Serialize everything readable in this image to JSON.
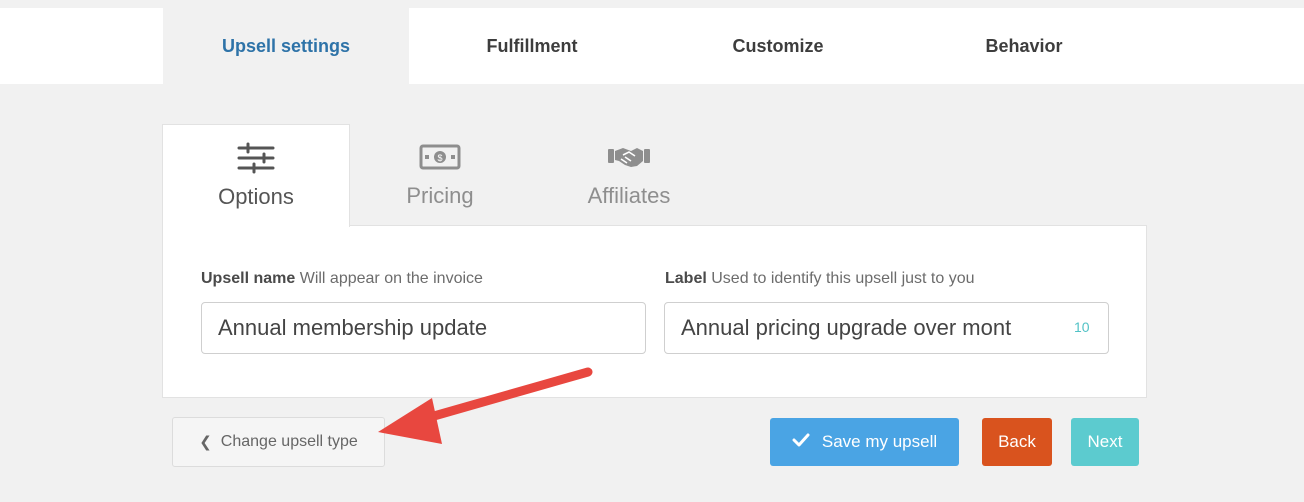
{
  "top_tabs": [
    {
      "label": "Upsell settings",
      "active": true
    },
    {
      "label": "Fulfillment",
      "active": false
    },
    {
      "label": "Customize",
      "active": false
    },
    {
      "label": "Behavior",
      "active": false
    }
  ],
  "sub_tabs": [
    {
      "label": "Options",
      "icon": "sliders-icon",
      "active": true
    },
    {
      "label": "Pricing",
      "icon": "money-icon",
      "active": false
    },
    {
      "label": "Affiliates",
      "icon": "handshake-icon",
      "active": false
    }
  ],
  "form": {
    "upsell_name": {
      "label": "Upsell name",
      "hint": "Will appear on the invoice",
      "value": "Annual membership update"
    },
    "label_field": {
      "label": "Label",
      "hint": "Used to identify this upsell just to you",
      "value": "Annual pricing upgrade over mont",
      "counter": "10"
    }
  },
  "buttons": {
    "change_type": "Change upsell type",
    "save": "Save my upsell",
    "back": "Back",
    "next": "Next"
  },
  "colors": {
    "active_tab_text": "#2e73a8",
    "save_button": "#4aa4e4",
    "back_button": "#d9531e",
    "next_button": "#5ccbcf",
    "annotation_arrow": "#e8473f",
    "counter": "#52c2c6"
  }
}
